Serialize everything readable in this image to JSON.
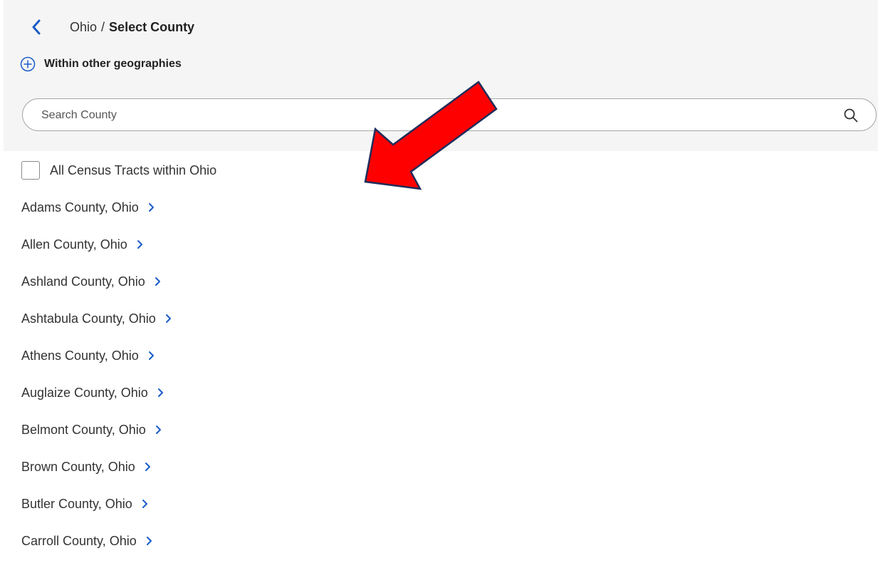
{
  "header": {
    "state": "Ohio",
    "separator": "/",
    "current": "Select County"
  },
  "within": {
    "label": "Within other geographies"
  },
  "search": {
    "placeholder": "Search County",
    "value": ""
  },
  "all_tracts": {
    "label": "All Census Tracts within Ohio",
    "checked": false
  },
  "counties": [
    {
      "label": "Adams County, Ohio"
    },
    {
      "label": "Allen County, Ohio"
    },
    {
      "label": "Ashland County, Ohio"
    },
    {
      "label": "Ashtabula County, Ohio"
    },
    {
      "label": "Athens County, Ohio"
    },
    {
      "label": "Auglaize County, Ohio"
    },
    {
      "label": "Belmont County, Ohio"
    },
    {
      "label": "Brown County, Ohio"
    },
    {
      "label": "Butler County, Ohio"
    },
    {
      "label": "Carroll County, Ohio"
    }
  ],
  "icons": {
    "back": "chevron-left-icon",
    "within": "plus-circle-icon",
    "search": "search-icon",
    "item": "chevron-right-icon"
  },
  "colors": {
    "accent": "#1a5cc8",
    "panel": "#f5f5f5",
    "arrow_fill": "#ff0000",
    "arrow_stroke": "#1f2d5a"
  }
}
